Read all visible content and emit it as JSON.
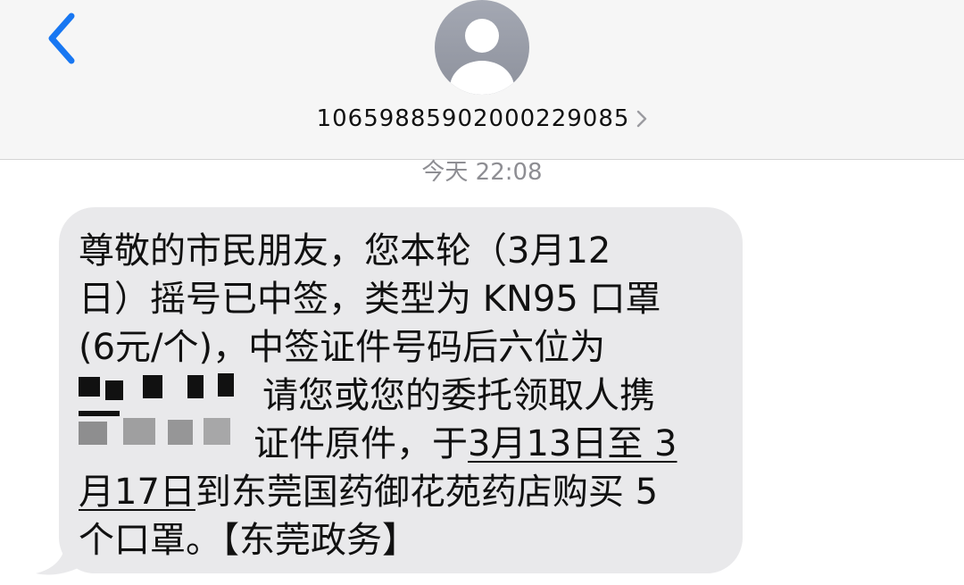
{
  "header": {
    "back_icon": "chevron-left-icon",
    "avatar_icon": "person-silhouette-icon",
    "contact_number": "10659885902000229085",
    "contact_chevron_icon": "chevron-right-icon"
  },
  "timestamp": "今天 22:08",
  "message": {
    "line1": "尊敬的市民朋友，您本轮（3月12",
    "line2": "日）摇号已中签，类型为 KN95 口罩",
    "line3": "(6元/个)，中签证件号码后六位为",
    "line4_visible": "请您或您的委托领取人携",
    "line5_visible": "证件原件，于",
    "line5_link": "3月13日至 3",
    "line6_link": "月17日",
    "line6_rest": "到东莞国药御花苑药店购买 5",
    "line7": "个口罩。【东莞政务】"
  },
  "colors": {
    "accent": "#1877f2",
    "bubble": "#e9e9eb",
    "header_bg": "#f6f6f6",
    "timestamp": "#8e8e93"
  }
}
